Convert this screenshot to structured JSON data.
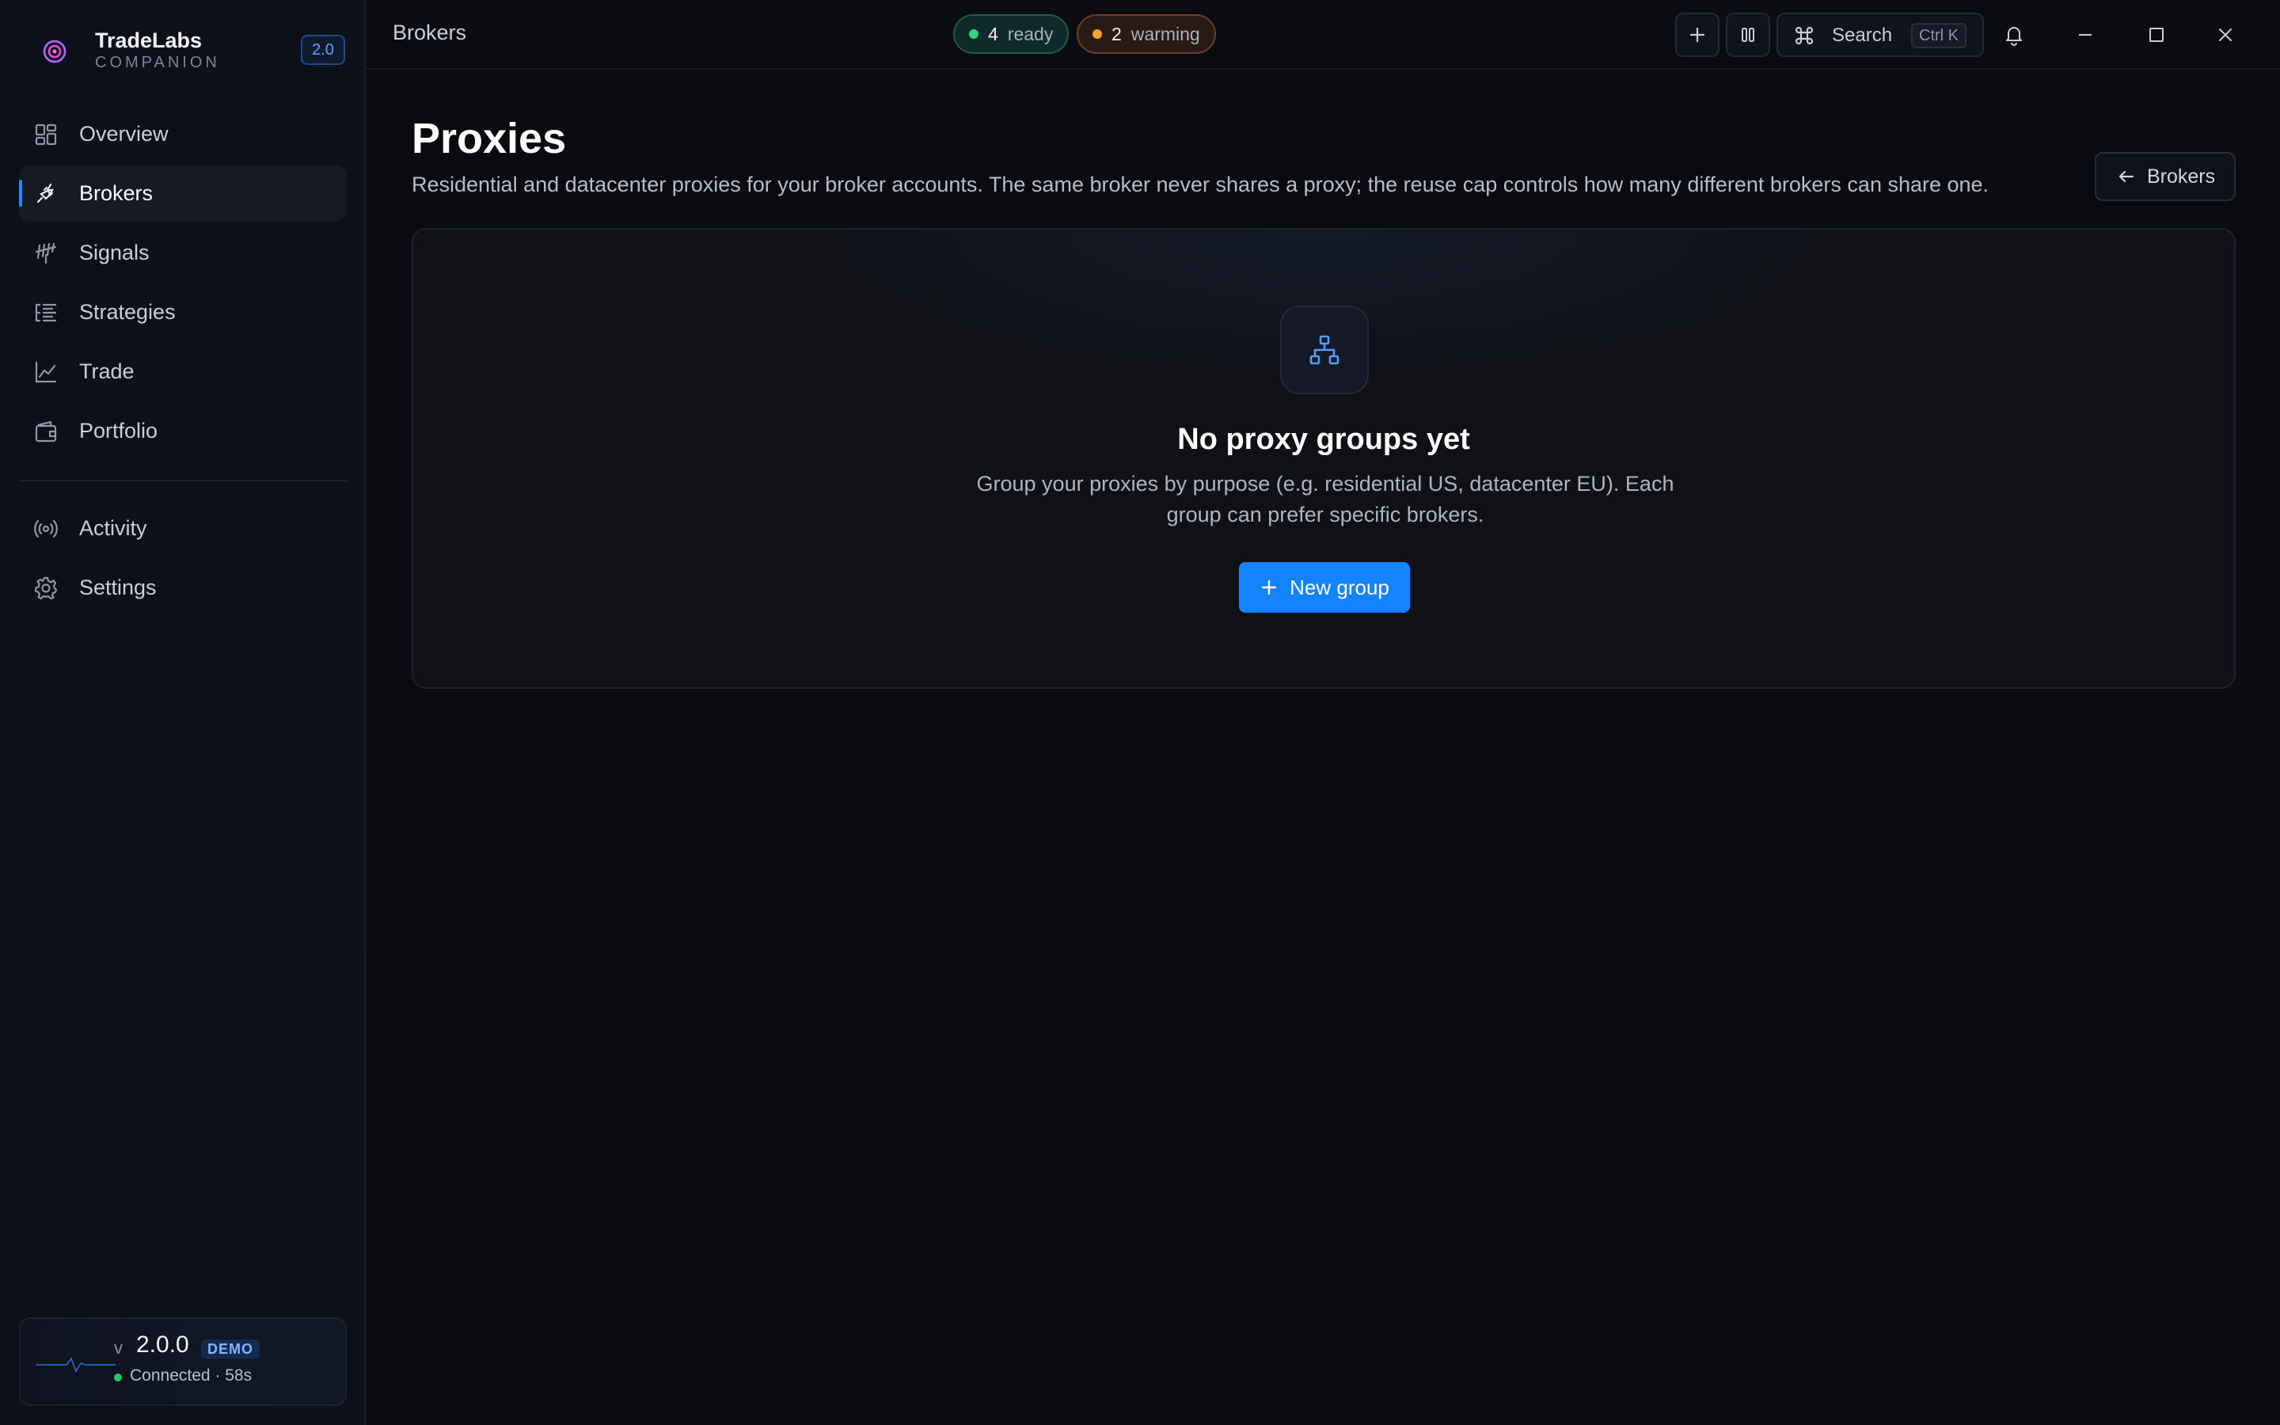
{
  "app": {
    "name": "TradeLabs",
    "subtitle": "COMPANION",
    "version_badge": "2.0"
  },
  "sidebar": {
    "nav": [
      {
        "label": "Overview",
        "icon": "grid-icon"
      },
      {
        "label": "Brokers",
        "icon": "plug-icon",
        "active": true
      },
      {
        "label": "Signals",
        "icon": "signal-icon"
      },
      {
        "label": "Strategies",
        "icon": "list-tree-icon"
      },
      {
        "label": "Trade",
        "icon": "line-chart-icon"
      },
      {
        "label": "Portfolio",
        "icon": "wallet-icon"
      }
    ],
    "nav_secondary": [
      {
        "label": "Activity",
        "icon": "broadcast-icon"
      },
      {
        "label": "Settings",
        "icon": "gear-icon"
      }
    ],
    "status": {
      "v_prefix": "v",
      "version": "2.0.0",
      "badge": "DEMO",
      "connection": "Connected · 58s"
    }
  },
  "topbar": {
    "title": "Brokers",
    "pills": {
      "ready": {
        "count": "4",
        "label": "ready"
      },
      "warming": {
        "count": "2",
        "label": "warming"
      }
    },
    "search": {
      "label": "Search",
      "shortcut": "Ctrl K"
    }
  },
  "page": {
    "title": "Proxies",
    "description": "Residential and datacenter proxies for your broker accounts. The same broker never shares a proxy; the reuse cap controls how many different brokers can share one.",
    "back_button": "Brokers"
  },
  "empty_state": {
    "title": "No proxy groups yet",
    "description": "Group your proxies by purpose (e.g. residential US, datacenter EU). Each group can prefer specific brokers.",
    "button": "New group"
  },
  "colors": {
    "accent": "#1483ff",
    "ready": "#2fd47d",
    "warming": "#f5a524",
    "background": "#0a0b10"
  }
}
